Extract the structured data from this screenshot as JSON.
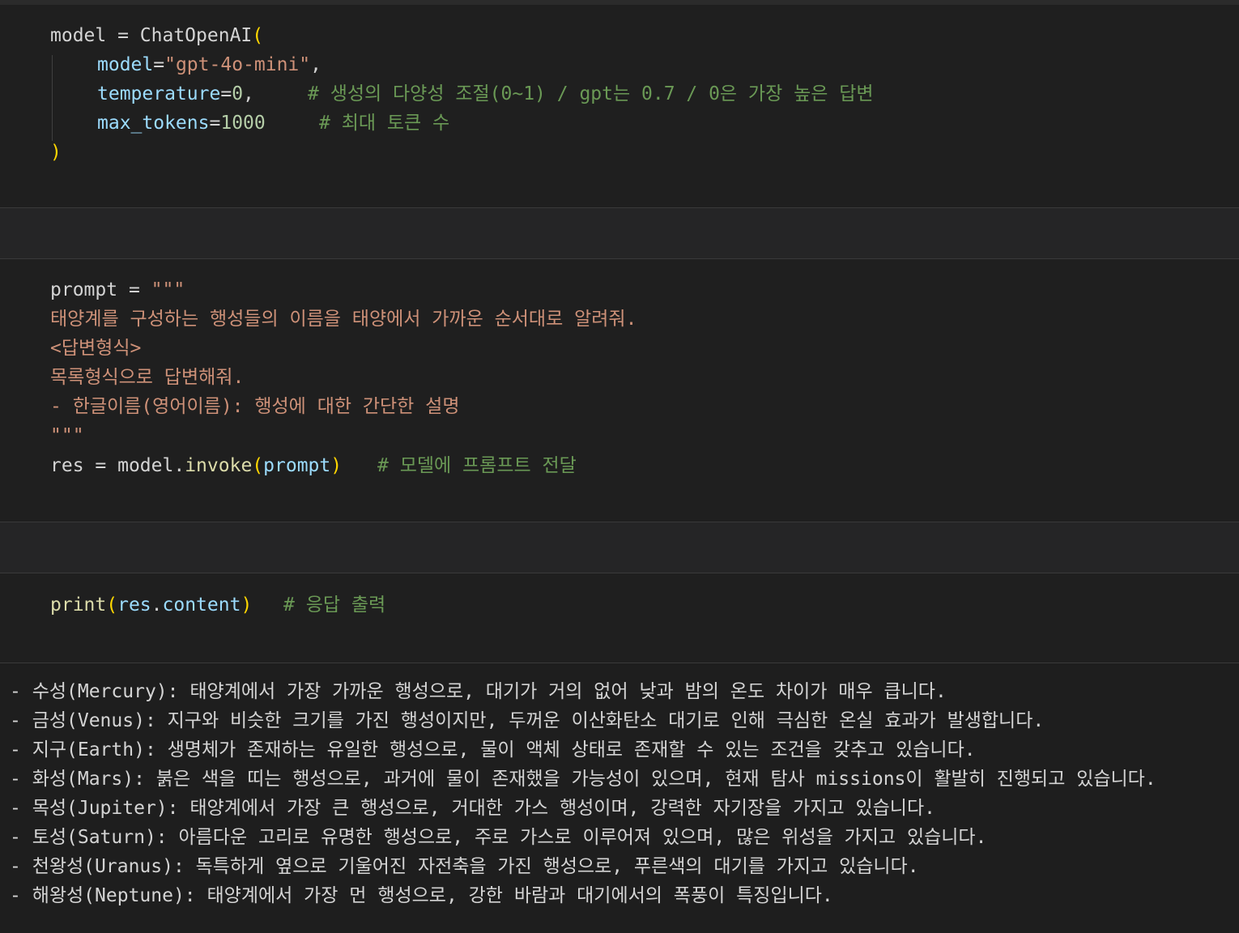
{
  "cell1": {
    "l1": {
      "var": "model",
      "eq": " = ",
      "fn": "ChatOpenAI",
      "open": "("
    },
    "l2": {
      "param": "model",
      "eq": "=",
      "val": "\"gpt-4o-mini\"",
      "comma": ","
    },
    "l3": {
      "param": "temperature",
      "eq": "=",
      "val": "0",
      "comma": ",",
      "comment": "# 생성의 다양성 조절(0~1) / gpt는 0.7 / 0은 가장 높은 답변"
    },
    "l4": {
      "param": "max_tokens",
      "eq": "=",
      "val": "1000",
      "comment": "# 최대 토큰 수"
    },
    "l5": {
      "close": ")"
    }
  },
  "cell2": {
    "l1": {
      "var": "prompt",
      "eq": " = ",
      "str": "\"\"\""
    },
    "l2": "태양계를 구성하는 행성들의 이름을 태양에서 가까운 순서대로 알려줘.",
    "l3": "<답변형식>",
    "l4": "목록형식으로 답변해줘.",
    "l5": "- 한글이름(영어이름): 행성에 대한 간단한 설명",
    "l6": "\"\"\"",
    "l7": {
      "var": "res",
      "eq": " = ",
      "obj": "model",
      "dot": ".",
      "fn": "invoke",
      "open": "(",
      "arg": "prompt",
      "close": ")",
      "comment": "# 모델에 프롬프트 전달"
    }
  },
  "cell3": {
    "l1": {
      "fn": "print",
      "open": "(",
      "obj": "res",
      "dot": ".",
      "attr": "content",
      "close": ")",
      "comment": "# 응답 출력"
    }
  },
  "output": [
    "- 수성(Mercury): 태양계에서 가장 가까운 행성으로, 대기가 거의 없어 낮과 밤의 온도 차이가 매우 큽니다.",
    "- 금성(Venus): 지구와 비슷한 크기를 가진 행성이지만, 두꺼운 이산화탄소 대기로 인해 극심한 온실 효과가 발생합니다.",
    "- 지구(Earth): 생명체가 존재하는 유일한 행성으로, 물이 액체 상태로 존재할 수 있는 조건을 갖추고 있습니다.",
    "- 화성(Mars): 붉은 색을 띠는 행성으로, 과거에 물이 존재했을 가능성이 있으며, 현재 탐사 missions이 활발히 진행되고 있습니다.",
    "- 목성(Jupiter): 태양계에서 가장 큰 행성으로, 거대한 가스 행성이며, 강력한 자기장을 가지고 있습니다.",
    "- 토성(Saturn): 아름다운 고리로 유명한 행성으로, 주로 가스로 이루어져 있으며, 많은 위성을 가지고 있습니다.",
    "- 천왕성(Uranus): 독특하게 옆으로 기울어진 자전축을 가진 행성으로, 푸른색의 대기를 가지고 있습니다.",
    "- 해왕성(Neptune): 태양계에서 가장 먼 행성으로, 강한 바람과 대기에서의 폭풍이 특징입니다."
  ]
}
